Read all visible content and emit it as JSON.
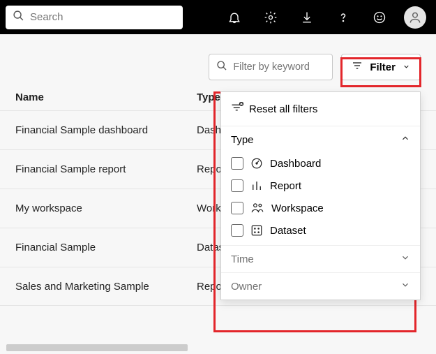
{
  "topbar": {
    "search_placeholder": "Search"
  },
  "actions": {
    "keyword_placeholder": "Filter by keyword",
    "filter_label": "Filter"
  },
  "columns": {
    "name": "Name",
    "type": "Type"
  },
  "rows": [
    {
      "name": "Financial Sample dashboard",
      "type": "Dashboard"
    },
    {
      "name": "Financial Sample report",
      "type": "Report"
    },
    {
      "name": "My workspace",
      "type": "Workspace"
    },
    {
      "name": "Financial Sample",
      "type": "Dataset"
    },
    {
      "name": "Sales and Marketing Sample",
      "type": "Report"
    }
  ],
  "filter_panel": {
    "reset_label": "Reset all filters",
    "sections": {
      "type": {
        "label": "Type",
        "options": [
          {
            "label": "Dashboard"
          },
          {
            "label": "Report"
          },
          {
            "label": "Workspace"
          },
          {
            "label": "Dataset"
          }
        ]
      },
      "time": {
        "label": "Time"
      },
      "owner": {
        "label": "Owner"
      }
    }
  }
}
